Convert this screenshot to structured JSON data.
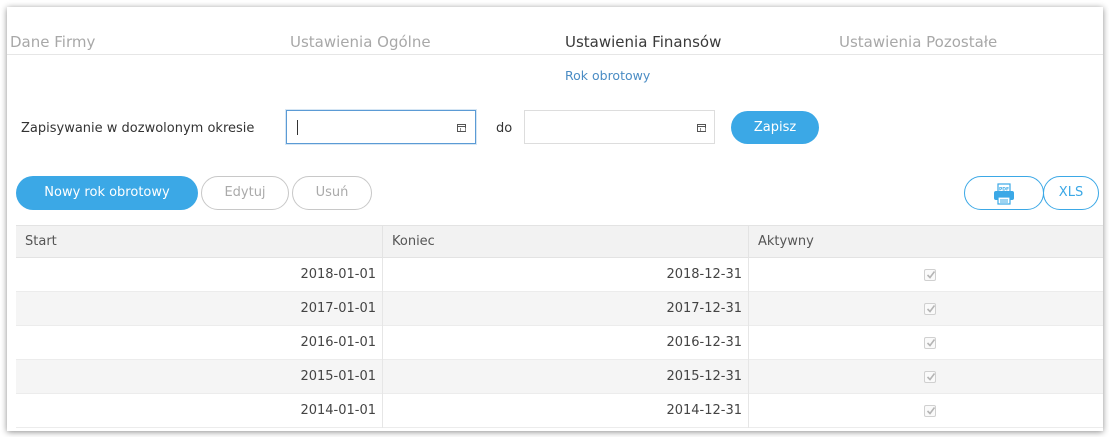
{
  "tabs": [
    {
      "label": "Dane Firmy",
      "active": false
    },
    {
      "label": "Ustawienia Ogólne",
      "active": false
    },
    {
      "label": "Ustawienia Finansów",
      "active": true
    },
    {
      "label": "Ustawienia Pozostałe",
      "active": false
    }
  ],
  "subtab": {
    "label": "Rok obrotowy"
  },
  "period": {
    "label": "Zapisywanie w dozwolonym okresie",
    "from_value": "",
    "to_label": "do",
    "to_value": "",
    "save_label": "Zapisz"
  },
  "toolbar": {
    "new_label": "Nowy rok obrotowy",
    "edit_label": "Edytuj",
    "delete_label": "Usuń",
    "pdf_icon": "pdf-print-icon",
    "xls_label": "XLS"
  },
  "table": {
    "headers": [
      "Start",
      "Koniec",
      "Aktywny"
    ],
    "rows": [
      {
        "start": "2018-01-01",
        "end": "2018-12-31",
        "active": true
      },
      {
        "start": "2017-01-01",
        "end": "2017-12-31",
        "active": true
      },
      {
        "start": "2016-01-01",
        "end": "2016-12-31",
        "active": true
      },
      {
        "start": "2015-01-01",
        "end": "2015-12-31",
        "active": true
      },
      {
        "start": "2014-01-01",
        "end": "2014-12-31",
        "active": true
      }
    ]
  },
  "colors": {
    "accent": "#3ba8e6",
    "link": "#4a8cc4",
    "header_bg": "#f2f2f2"
  }
}
